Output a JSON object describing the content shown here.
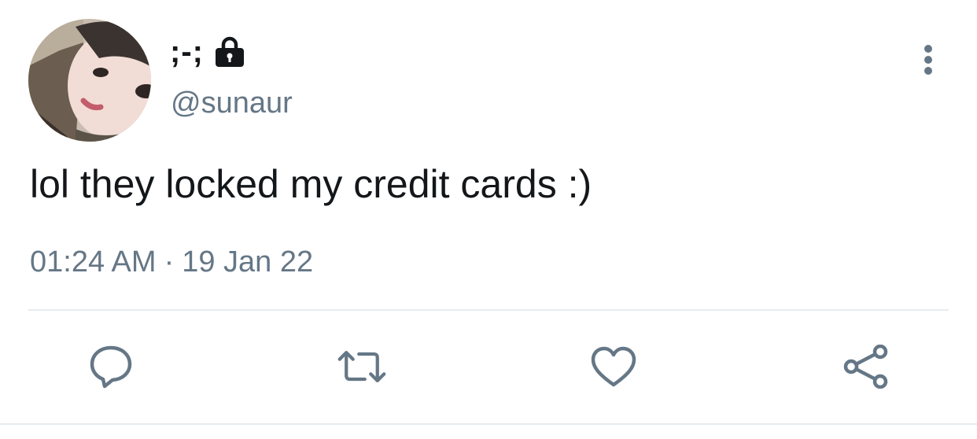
{
  "tweet": {
    "author": {
      "display_name": ";-;",
      "handle": "@sunaur",
      "protected_icon": "lock-icon",
      "avatar": "avatar-photo"
    },
    "text": "lol they locked my credit cards :)",
    "time": "01:24 AM",
    "separator": "·",
    "date": "19 Jan 22",
    "menu_icon": "more-vertical-icon"
  },
  "actions": [
    {
      "name": "reply",
      "icon": "reply-icon"
    },
    {
      "name": "retweet",
      "icon": "retweet-icon"
    },
    {
      "name": "like",
      "icon": "heart-icon"
    },
    {
      "name": "share",
      "icon": "share-icon"
    }
  ],
  "colors": {
    "text_primary": "#14171a",
    "text_secondary": "#657786",
    "icon_gray": "#657786",
    "divider": "#e6ecf0",
    "background": "#ffffff"
  }
}
